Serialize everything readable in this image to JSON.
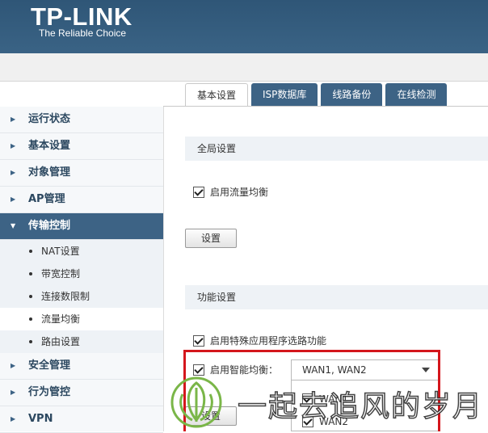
{
  "header": {
    "logo": "TP-LINK",
    "tagline": "The Reliable Choice"
  },
  "tabs": [
    {
      "label": "基本设置",
      "active": true
    },
    {
      "label": "ISP数据库",
      "active": false
    },
    {
      "label": "线路备份",
      "active": false
    },
    {
      "label": "在线检测",
      "active": false
    }
  ],
  "sidebar": {
    "items": [
      {
        "label": "运行状态"
      },
      {
        "label": "基本设置"
      },
      {
        "label": "对象管理"
      },
      {
        "label": "AP管理"
      },
      {
        "label": "传输控制",
        "open": true
      },
      {
        "label": "安全管理"
      },
      {
        "label": "行为管控"
      },
      {
        "label": "VPN"
      }
    ],
    "subitems": [
      {
        "label": "NAT设置"
      },
      {
        "label": "带宽控制"
      },
      {
        "label": "连接数限制"
      },
      {
        "label": "流量均衡",
        "active": true
      },
      {
        "label": "路由设置"
      }
    ]
  },
  "global": {
    "title": "全局设置",
    "enable_balance_label": "启用流量均衡",
    "enable_balance_checked": true,
    "set_button": "设置"
  },
  "function": {
    "title": "功能设置",
    "special_app_label": "启用特殊应用程序选路功能",
    "special_app_checked": true,
    "smart_balance_label": "启用智能均衡：",
    "smart_balance_checked": true,
    "select_value": "WAN1, WAN2",
    "options": [
      {
        "label": "WAN1",
        "checked": true
      },
      {
        "label": "WAN2",
        "checked": true
      }
    ],
    "set_button": "设置"
  },
  "watermark": {
    "text": "一起去追风的岁月"
  },
  "colors": {
    "header_bg": "#2f5677",
    "accent": "#3d6385",
    "highlight": "#d4161c"
  }
}
